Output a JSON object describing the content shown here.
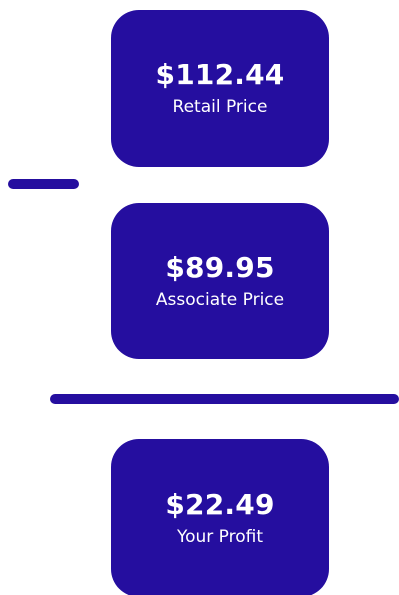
{
  "cards": [
    {
      "amount": "$112.44",
      "label": "Retail Price"
    },
    {
      "amount": "$89.95",
      "label": "Associate Price"
    },
    {
      "amount": "$22.49",
      "label": "Your Profit"
    }
  ],
  "colors": {
    "card_background": "#250e9f",
    "card_text": "#ffffff",
    "page_background": "#ffffff"
  }
}
